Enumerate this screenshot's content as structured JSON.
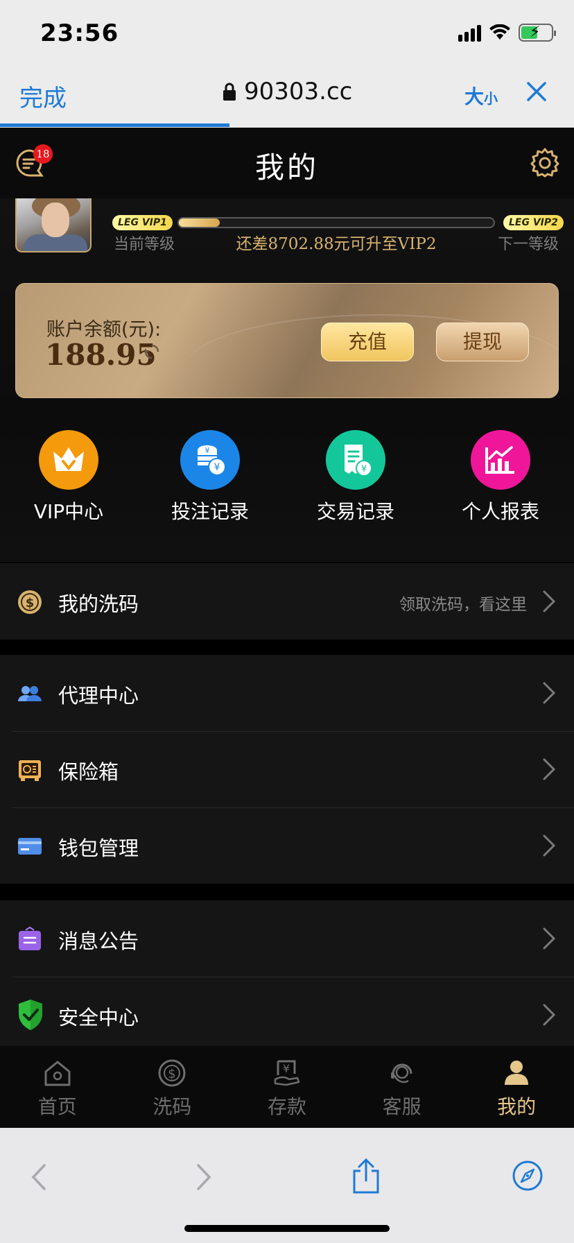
{
  "status_bar": {
    "time": "23:56"
  },
  "browser": {
    "done_label": "完成",
    "url": "90303.cc",
    "size_label_big": "大",
    "size_label_small": "小",
    "load_progress": 0.4
  },
  "header": {
    "title": "我的",
    "unread_count": "18"
  },
  "profile": {
    "current_badge": "LEG VIP1",
    "next_badge": "LEG VIP2",
    "current_level_label": "当前等级",
    "next_level_label": "下一等级",
    "upgrade_text": "还差8702.88元可升至VIP2",
    "vip_progress": 0.13
  },
  "balance": {
    "label": "账户余额(元):",
    "amount": "188.95",
    "recharge_label": "充值",
    "withdraw_label": "提现"
  },
  "quick_actions": [
    {
      "label": "VIP中心",
      "icon": "crown-icon",
      "color": "#f59a0c"
    },
    {
      "label": "投注记录",
      "icon": "coins-icon",
      "color": "#1b86e8"
    },
    {
      "label": "交易记录",
      "icon": "receipt-icon",
      "color": "#14c79a"
    },
    {
      "label": "个人报表",
      "icon": "chart-icon",
      "color": "#f0169a"
    }
  ],
  "menu": {
    "rebate": {
      "label": "我的洗码",
      "hint": "领取洗码，看这里"
    },
    "agent": {
      "label": "代理中心"
    },
    "safe": {
      "label": "保险箱"
    },
    "wallet": {
      "label": "钱包管理"
    },
    "notice": {
      "label": "消息公告"
    },
    "security": {
      "label": "安全中心"
    }
  },
  "tabs": [
    {
      "label": "首页",
      "icon": "home-icon"
    },
    {
      "label": "洗码",
      "icon": "rebate-icon"
    },
    {
      "label": "存款",
      "icon": "deposit-icon"
    },
    {
      "label": "客服",
      "icon": "support-icon"
    },
    {
      "label": "我的",
      "icon": "user-icon",
      "active": true
    }
  ],
  "colors": {
    "gold": "#e6c68a",
    "link_blue": "#1d7ad6",
    "badge_red": "#e5191f"
  }
}
